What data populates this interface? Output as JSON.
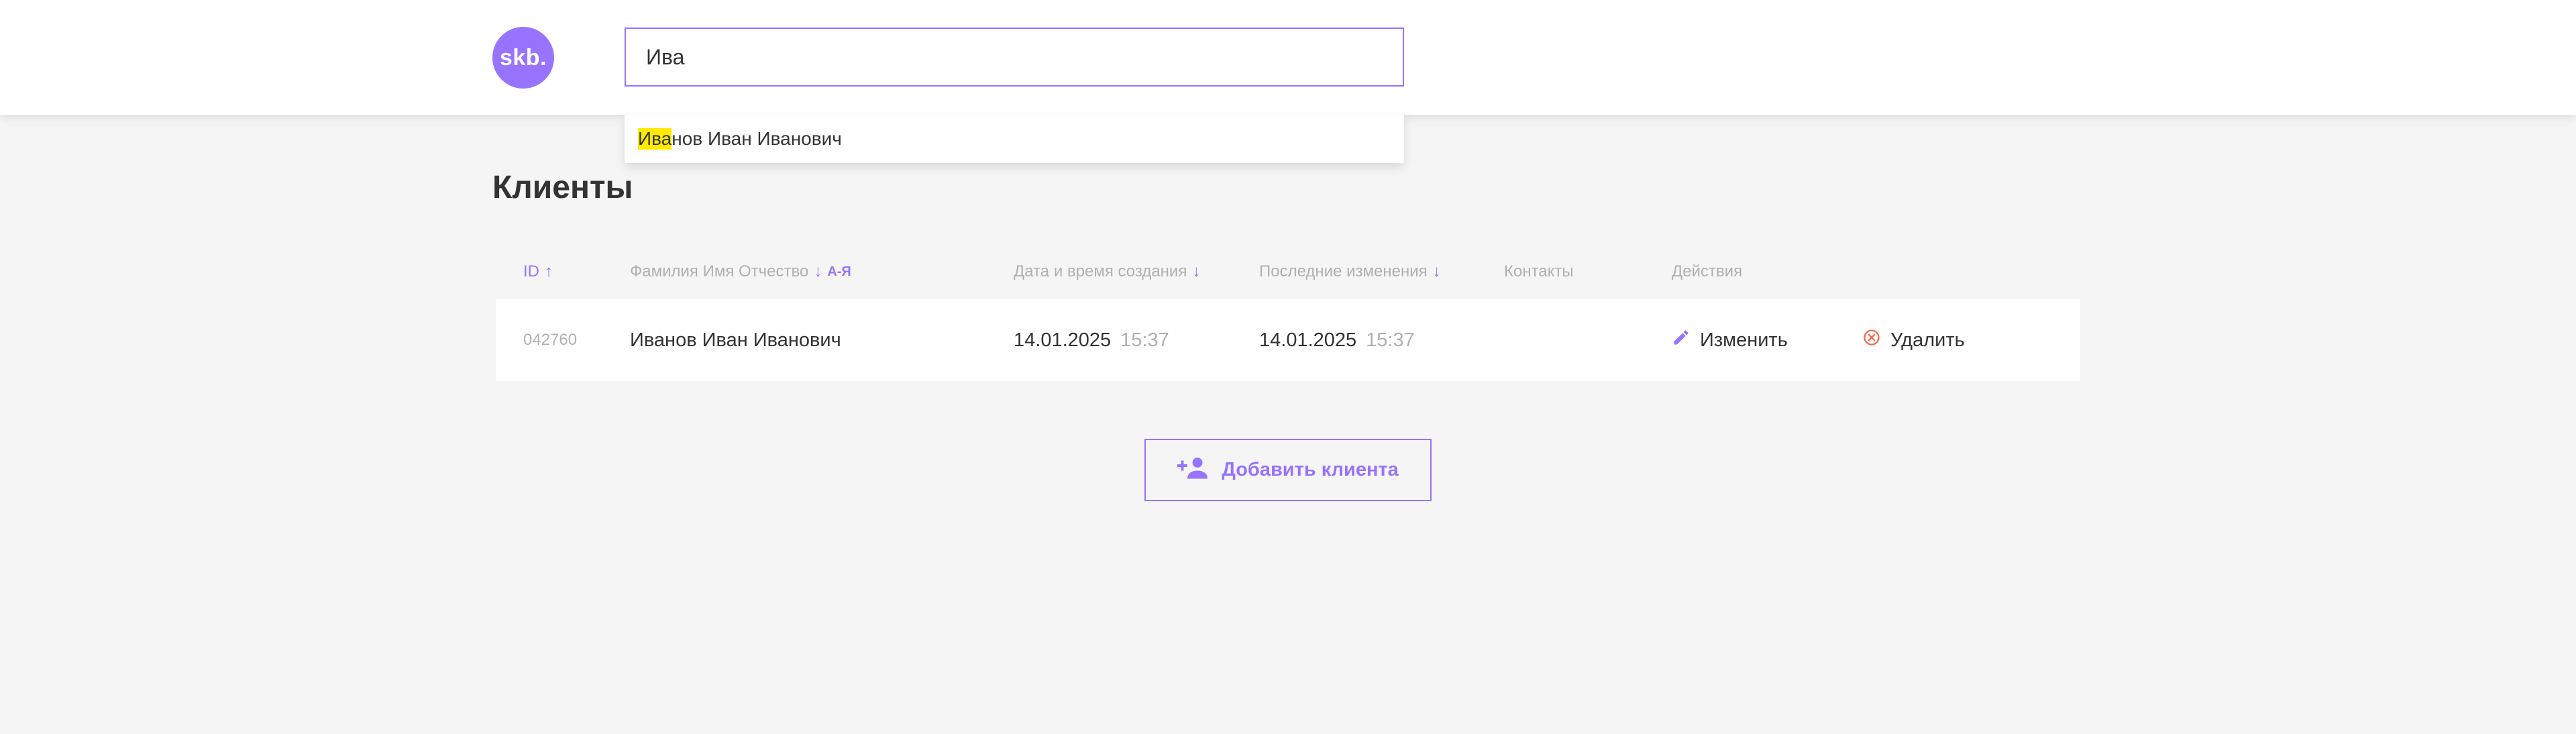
{
  "header": {
    "logo_text": "skb.",
    "search_value": "Ива"
  },
  "autocomplete": {
    "match": "Ива",
    "rest": "нов Иван Иванович"
  },
  "page": {
    "title": "Клиенты"
  },
  "table": {
    "columns": {
      "id": "ID",
      "name": "Фамилия Имя Отчество",
      "name_sort_hint": "А-Я",
      "created": "Дата и время создания",
      "updated": "Последние изменения",
      "contacts": "Контакты",
      "actions": "Действия"
    },
    "rows": [
      {
        "id": "042760",
        "name": "Иванов Иван Иванович",
        "created_date": "14.01.2025",
        "created_time": "15:37",
        "updated_date": "14.01.2025",
        "updated_time": "15:37",
        "edit_label": "Изменить",
        "delete_label": "Удалить"
      }
    ]
  },
  "add_button": {
    "label": "Добавить клиента"
  },
  "colors": {
    "accent": "#9873ff",
    "delete": "#f06a4d",
    "highlight": "#ffea00",
    "background": "#f5f5f5",
    "muted": "#b0b0b0",
    "text": "#333333"
  },
  "icons": {
    "logo": "logo",
    "sort_asc": "arrow-up-icon",
    "sort_desc": "arrow-down-icon",
    "edit": "pencil-icon",
    "delete": "cancel-circle-icon",
    "add": "add-user-icon"
  }
}
